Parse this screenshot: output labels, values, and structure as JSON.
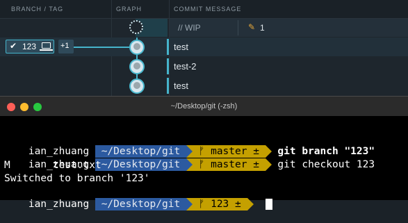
{
  "graph_header": {
    "branch_tag": "BRANCH / TAG",
    "graph": "GRAPH",
    "commit_message": "COMMIT MESSAGE"
  },
  "wip_row": {
    "label": "// WIP",
    "change_count": "1"
  },
  "branch_badge": {
    "name": "123",
    "extra": "+1"
  },
  "commits": [
    {
      "message": "test"
    },
    {
      "message": "test-2"
    },
    {
      "message": "test"
    }
  ],
  "terminal": {
    "title": "~/Desktop/git (-zsh)",
    "lines": [
      {
        "user": "ian_zhuang",
        "path": "~/Desktop/git",
        "branch_prefix": "ᚠ master ±",
        "branch_suffix": "",
        "cmd_bold": "git branch \"123\"",
        "cmd_rest": ""
      },
      {
        "user": "ian_zhuang",
        "path": "~/Desktop/git",
        "branch_prefix": "ᚠ master ±",
        "branch_suffix": "",
        "cmd_bold": "",
        "cmd_rest": "git checkout 123"
      },
      {
        "output": "M       test.txt"
      },
      {
        "output": "Switched to branch '123'"
      },
      {
        "user": "ian_zhuang",
        "path": "~/Desktop/git",
        "branch_prefix": "ᚠ 123 ±",
        "branch_suffix": "",
        "cmd_bold": "",
        "cmd_rest": ""
      }
    ]
  },
  "colors": {
    "accent": "#46b5cc",
    "path_bg": "#2c5aa0",
    "git_bg": "#c4a000"
  }
}
